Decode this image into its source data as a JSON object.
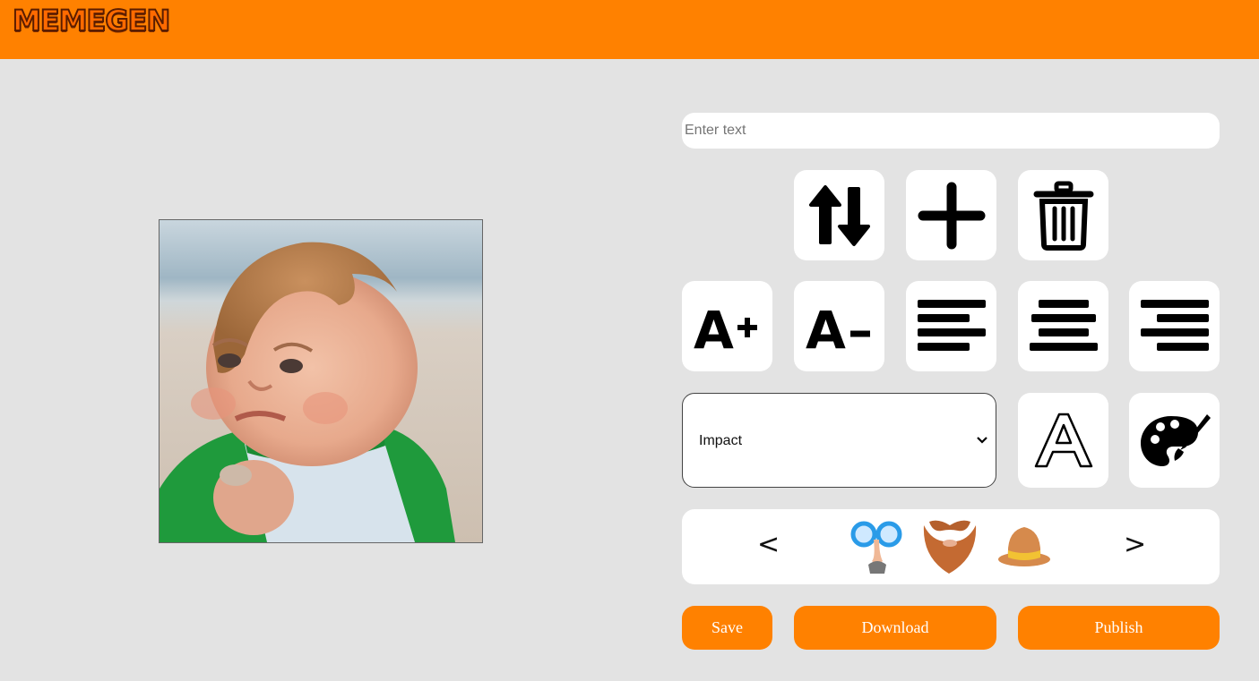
{
  "header": {
    "logo_text": "MEMEGEN",
    "background_color": "#ff8100"
  },
  "canvas": {
    "image_description_icon": "success-kid-meme-image"
  },
  "editor": {
    "text_input": {
      "placeholder": "Enter text",
      "value": ""
    },
    "row1": [
      {
        "icon": "switch-lines-icon"
      },
      {
        "icon": "add-line-icon"
      },
      {
        "icon": "delete-line-icon"
      }
    ],
    "row2": [
      {
        "icon": "increase-font-icon",
        "glyph": "A+"
      },
      {
        "icon": "decrease-font-icon",
        "glyph": "A-"
      },
      {
        "icon": "align-left-icon"
      },
      {
        "icon": "align-center-icon"
      },
      {
        "icon": "align-right-icon"
      }
    ],
    "font_select": {
      "selected": "Impact"
    },
    "stroke_icon": "stroke-color-icon",
    "fill_icon": "fill-color-palette-icon",
    "stickers": {
      "prev_label": "<",
      "next_label": ">",
      "items": [
        "glasses-nose-sticker",
        "beard-sticker",
        "hat-sticker"
      ]
    },
    "buttons": {
      "save": "Save",
      "download": "Download",
      "publish": "Publish"
    },
    "accent_color": "#ff8100"
  }
}
